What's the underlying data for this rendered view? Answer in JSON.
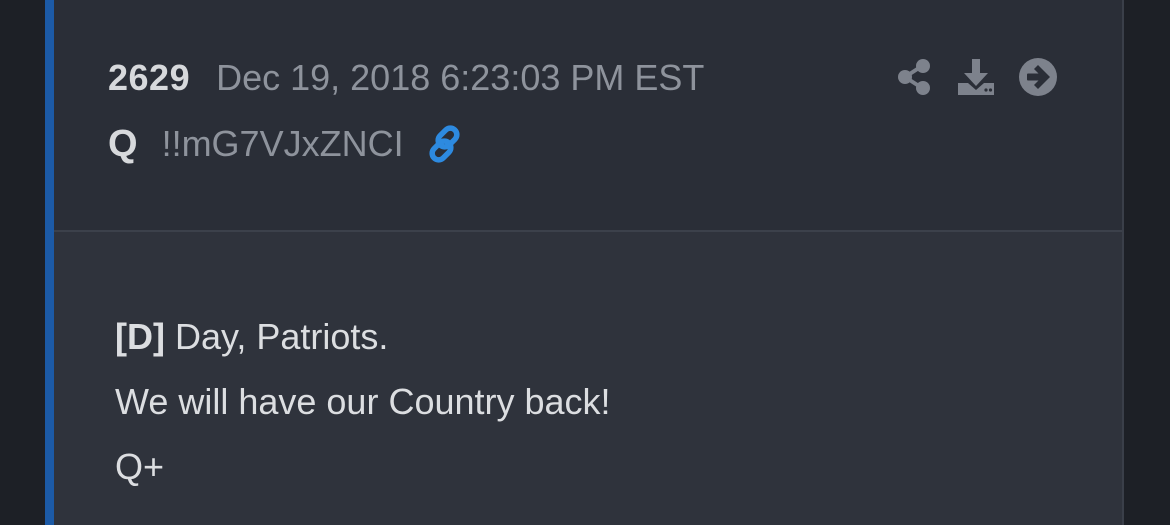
{
  "post": {
    "number": "2629",
    "timestamp": "Dec 19, 2018 6:23:03 PM EST",
    "author": "Q",
    "tripcode": "!!mG7VJxZNCI",
    "body": {
      "line1_tag": "[D]",
      "line1_rest": " Day, Patriots.",
      "line2": "We will have our Country back!",
      "line3": "Q+"
    }
  },
  "icons": {
    "link": "link-icon",
    "share": "share-icon",
    "download": "download-icon",
    "goto": "arrow-right-circle-icon"
  },
  "colors": {
    "accent": "#1c5aa6",
    "link_icon": "#2d8ae0",
    "action_icon": "#7d828c"
  }
}
